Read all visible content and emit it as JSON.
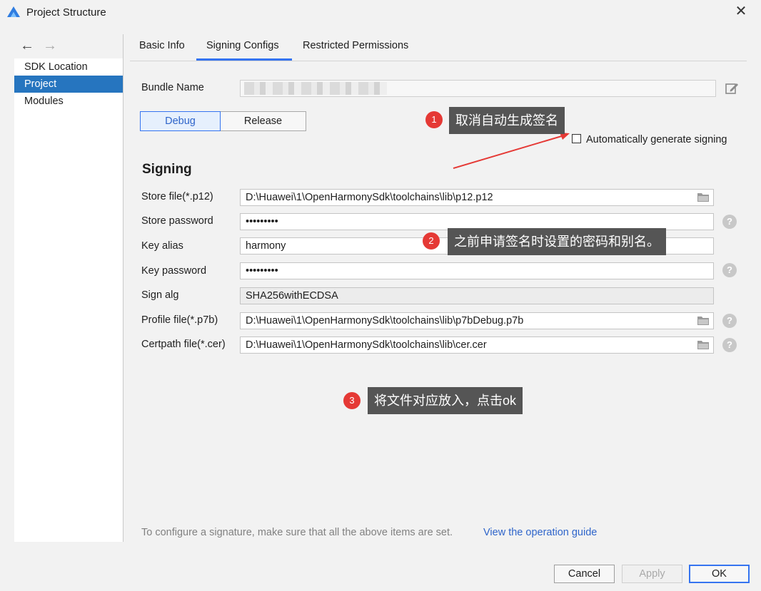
{
  "window": {
    "title": "Project Structure",
    "close_glyph": "✕"
  },
  "nav": {
    "back": "←",
    "forward": "→"
  },
  "sidebar": {
    "items": [
      {
        "label": "SDK Location"
      },
      {
        "label": "Project"
      },
      {
        "label": "Modules"
      }
    ]
  },
  "tabs": [
    {
      "label": "Basic Info"
    },
    {
      "label": "Signing Configs"
    },
    {
      "label": "Restricted Permissions"
    }
  ],
  "bundle": {
    "label": "Bundle Name"
  },
  "mode": {
    "debug": "Debug",
    "release": "Release"
  },
  "auto_sign": {
    "label": "Automatically generate signing",
    "checked": false
  },
  "signing": {
    "heading": "Signing",
    "fields": [
      {
        "label": "Store file(*.p12)",
        "value": "D:\\Huawei\\1\\OpenHarmonySdk\\toolchains\\lib\\p12.p12"
      },
      {
        "label": "Store password",
        "value": "•••••••••"
      },
      {
        "label": "Key alias",
        "value": "harmony"
      },
      {
        "label": "Key password",
        "value": "•••••••••"
      },
      {
        "label": "Sign alg",
        "value": "SHA256withECDSA"
      },
      {
        "label": "Profile file(*.p7b)",
        "value": "D:\\Huawei\\1\\OpenHarmonySdk\\toolchains\\lib\\p7bDebug.p7b"
      },
      {
        "label": "Certpath file(*.cer)",
        "value": "D:\\Huawei\\1\\OpenHarmonySdk\\toolchains\\lib\\cer.cer"
      }
    ]
  },
  "help_glyph": "?",
  "annotations": [
    {
      "num": "1",
      "text": "取消自动生成签名"
    },
    {
      "num": "2",
      "text": "之前申请签名时设置的密码和别名。"
    },
    {
      "num": "3",
      "text": "将文件对应放入，点击ok"
    }
  ],
  "footer": {
    "hint": "To configure a signature, make sure that all the above items are set.",
    "link": "View the operation guide"
  },
  "buttons": {
    "cancel": "Cancel",
    "apply": "Apply",
    "ok": "OK"
  },
  "colors": {
    "accent": "#3574f0",
    "selection": "#2675bf",
    "link": "#2f65ca",
    "badge": "#e53935",
    "callout": "#555555",
    "arrow": "#e53935"
  }
}
